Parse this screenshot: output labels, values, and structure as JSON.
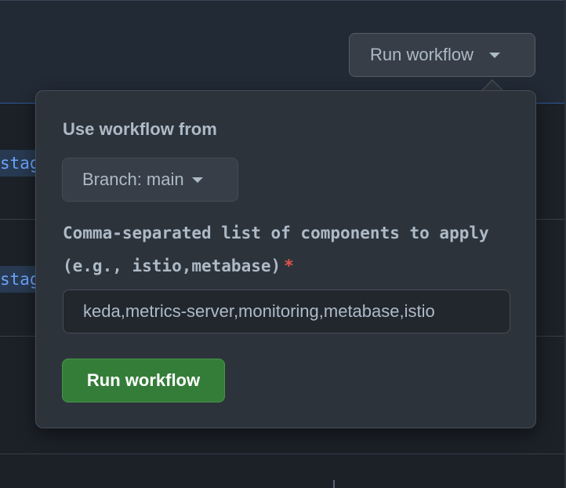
{
  "trigger_button": {
    "label": "Run workflow"
  },
  "background": {
    "tag_1": "stag",
    "tag_2": "stag"
  },
  "popover": {
    "source_label": "Use workflow from",
    "branch_button": {
      "label": "Branch: main"
    },
    "input_label": "Comma-separated list of components to apply (e.g., istio,metabase)",
    "required_marker": "*",
    "input_value": "keda,metrics-server,monitoring,metabase,istio",
    "submit_button": {
      "label": "Run workflow"
    }
  },
  "icons": {
    "trigger_caret": "chevron-down-icon",
    "branch_caret": "chevron-down-icon"
  },
  "colors": {
    "background": "#1c2128",
    "popover": "#2d333b",
    "primary_green": "#347d39",
    "required_red": "#e5534b",
    "link_blue": "#6ca4f8"
  }
}
